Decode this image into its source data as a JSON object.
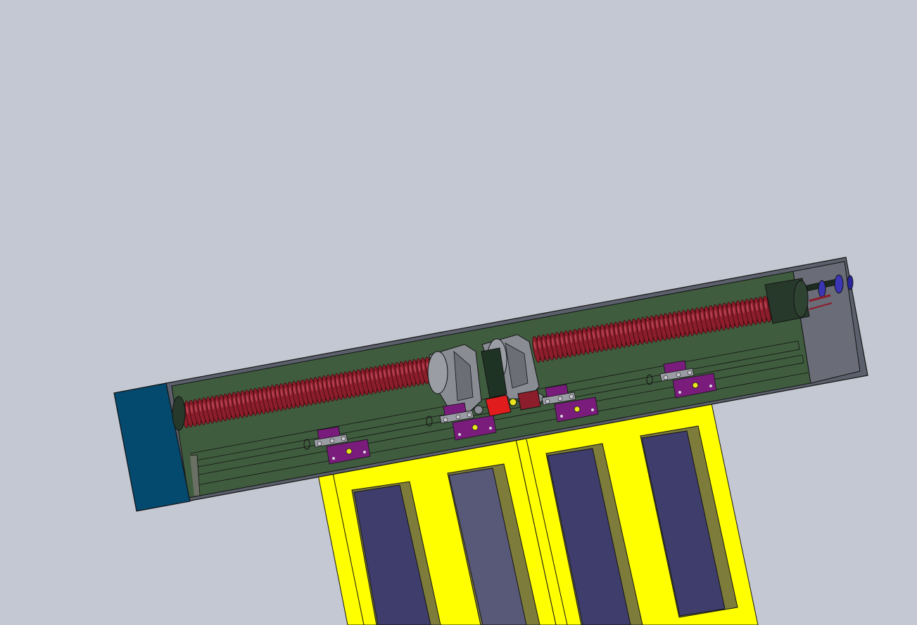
{
  "viewport": {
    "background_color": "#c4c8d2"
  },
  "model": {
    "colors": {
      "housing_frame": "#5c606c",
      "housing_interior": "#3f5c3e",
      "end_cap": "#04496e",
      "right_end_block": "#6a6c78",
      "screw_thread": "#8b1e2a",
      "screw_highlight": "#b44050",
      "nut_bracket": "#8a8c94",
      "motor_block": "#26392a",
      "coupling_blue": "#3a36b4",
      "door_frame": "#ffff00",
      "door_frame_shade": "#b9b72c",
      "glass_panel": "#3e3d6c",
      "glass_panel_light": "#585878",
      "glass_inner_edge": "#7e7c3a",
      "hanger_bracket": "#7a1c7c",
      "red_connector": "#e01c1c",
      "bolt_yellow": "#e8e61e",
      "outline": "#141414"
    },
    "screw_left_turns": 60,
    "screw_right_turns": 56
  }
}
